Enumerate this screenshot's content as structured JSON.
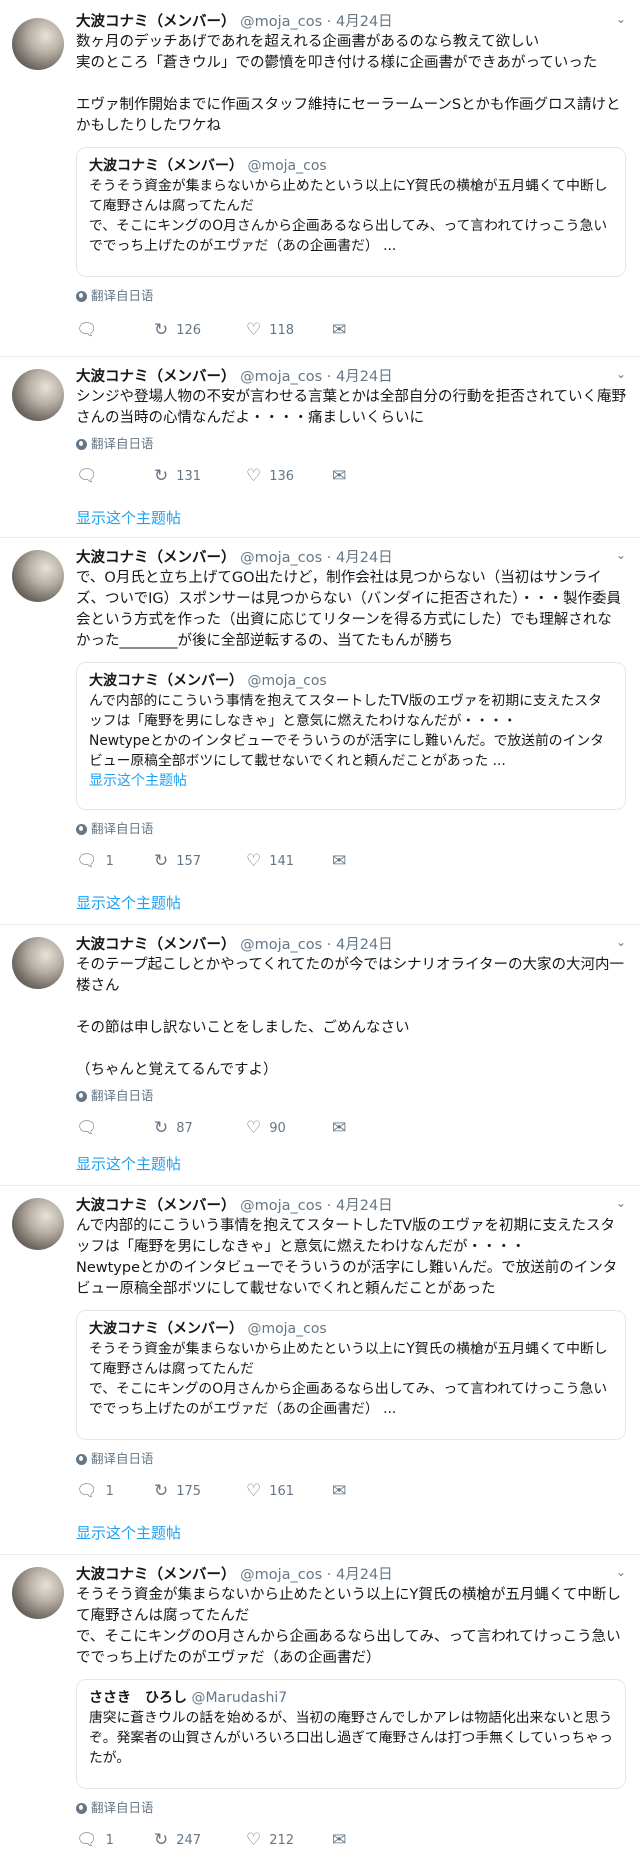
{
  "ui": {
    "translate_label": "翻译自日语",
    "show_thread_label": "显示这个主题帖"
  },
  "tweets": [
    {
      "name": "大波コナミ（メンバー）",
      "handle": "@moja_cos",
      "date": "4月24日",
      "text": "数ヶ月のデッチあげであれを超えれる企画書があるのなら教えて欲しい\n実のところ「蒼きウル」での鬱憤を叩き付ける様に企画書ができあがっていった\n\nエヴァ制作開始までに作画スタッフ維持にセーラームーンSとかも作画グロス請けとかもしたりしたワケね",
      "quote": {
        "name": "大波コナミ（メンバー）",
        "handle": "@moja_cos",
        "text": "そうそう資金が集まらないから止めたという以上にY賀氏の横槍が五月蝿くて中断して庵野さんは腐ってたんだ\nで、そこにキングのO月さんから企画あるなら出してみ、って言われてけっこう急いででっち上げたのがエヴァだ（あの企画書だ） ..."
      },
      "replies": "",
      "retweets": "126",
      "likes": "118"
    },
    {
      "name": "大波コナミ（メンバー）",
      "handle": "@moja_cos",
      "date": "4月24日",
      "text": "シンジや登場人物の不安が言わせる言葉とかは全部自分の行動を拒否されていく庵野さんの当時の心情なんだよ・・・・痛ましいくらいに",
      "replies": "",
      "retweets": "131",
      "likes": "136"
    },
    {
      "name": "大波コナミ（メンバー）",
      "handle": "@moja_cos",
      "date": "4月24日",
      "text": "で、O月氏と立ち上げてGO出たけど，制作会社は見つからない（当初はサンライズ、ついでIG）スポンサーは見つからない（バンダイに拒否された）・・・製作委員会という方式を作った（出資に応じてリターンを得る方式にした）でも理解されなかった________が後に全部逆転するの、当てたもんが勝ち",
      "quote": {
        "name": "大波コナミ（メンバー）",
        "handle": "@moja_cos",
        "text": "んで内部的にこういう事情を抱えてスタートしたTV版のエヴァを初期に支えたスタッフは「庵野を男にしなきゃ」と意気に燃えたわけなんだが・・・・\nNewtypeとかのインタビューでそういうのが活字にし難いんだ。で放送前のインタビュー原稿全部ボツにして載せないでくれと頼んだことがあった ...",
        "show_thread": "显示这个主题帖"
      },
      "replies": "1",
      "retweets": "157",
      "likes": "141"
    },
    {
      "name": "大波コナミ（メンバー）",
      "handle": "@moja_cos",
      "date": "4月24日",
      "text": "そのテープ起こしとかやってくれてたのが今ではシナリオライターの大家の大河内一楼さん\n\nその節は申し訳ないことをしました、ごめんなさい\n\n（ちゃんと覚えてるんですよ）",
      "replies": "",
      "retweets": "87",
      "likes": "90"
    },
    {
      "name": "大波コナミ（メンバー）",
      "handle": "@moja_cos",
      "date": "4月24日",
      "text": "んで内部的にこういう事情を抱えてスタートしたTV版のエヴァを初期に支えたスタッフは「庵野を男にしなきゃ」と意気に燃えたわけなんだが・・・・\nNewtypeとかのインタビューでそういうのが活字にし難いんだ。で放送前のインタビュー原稿全部ボツにして載せないでくれと頼んだことがあった",
      "quote": {
        "name": "大波コナミ（メンバー）",
        "handle": "@moja_cos",
        "text": "そうそう資金が集まらないから止めたという以上にY賀氏の横槍が五月蝿くて中断して庵野さんは腐ってたんだ\nで、そこにキングのO月さんから企画あるなら出してみ、って言われてけっこう急いででっち上げたのがエヴァだ（あの企画書だ） ..."
      },
      "replies": "1",
      "retweets": "175",
      "likes": "161"
    },
    {
      "name": "大波コナミ（メンバー）",
      "handle": "@moja_cos",
      "date": "4月24日",
      "text": "そうそう資金が集まらないから止めたという以上にY賀氏の横槍が五月蝿くて中断して庵野さんは腐ってたんだ\nで、そこにキングのO月さんから企画あるなら出してみ、って言われてけっこう急いででっち上げたのがエヴァだ（あの企画書だ）",
      "quote": {
        "name": "ささき　ひろし",
        "handle": "@Marudashi7",
        "text": "唐突に蒼きウルの話を始めるが、当初の庵野さんでしかアレは物語化出来ないと思うぞ。発案者の山賀さんがいろいろ口出し過ぎて庵野さんは打つ手無くしていっちゃったが。"
      },
      "replies": "1",
      "retweets": "247",
      "likes": "212"
    }
  ]
}
